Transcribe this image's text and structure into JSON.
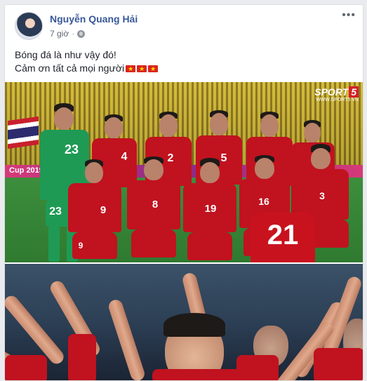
{
  "post": {
    "author": "Nguyễn Quang Hải",
    "time": "7 giờ",
    "separator": "·",
    "more": "•••",
    "line1": "Bóng đá là như vậy đó!",
    "line2": "Cảm ơn tất cả mọi người"
  },
  "photo1": {
    "watermark_main": "SPORT",
    "watermark_five": "5",
    "watermark_sub": "WWW.SPORT5.VN",
    "banner_text": "Cup 2019",
    "jersey_numbers": [
      "23",
      "4",
      "2",
      "5",
      "2",
      "9",
      "8",
      "19",
      "16",
      "3",
      "21"
    ]
  },
  "colors": {
    "link": "#385898",
    "jersey_red": "#c1121f",
    "keeper_green": "#1f9a55",
    "flag_red": "#da251d"
  }
}
